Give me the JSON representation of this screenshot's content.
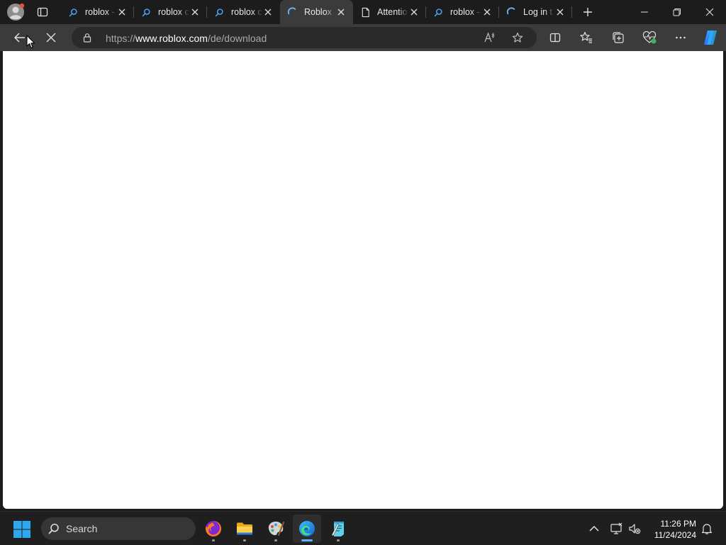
{
  "browser": {
    "tabs": [
      {
        "title": "roblox -",
        "favicon": "search-icon",
        "active": false
      },
      {
        "title": "roblox c",
        "favicon": "search-icon",
        "active": false
      },
      {
        "title": "roblox c",
        "favicon": "search-icon",
        "active": false
      },
      {
        "title": "Roblox",
        "favicon": "loading-spinner-icon",
        "active": true
      },
      {
        "title": "Attentio",
        "favicon": "document-icon",
        "active": false
      },
      {
        "title": "roblox -",
        "favicon": "search-icon",
        "active": false
      },
      {
        "title": "Log in t",
        "favicon": "loading-spinner-icon",
        "active": false
      }
    ],
    "address": {
      "scheme": "https://",
      "host": "www.roblox.com",
      "path": "/de/download"
    }
  },
  "taskbar": {
    "search_label": "Search",
    "apps": [
      "firefox-icon",
      "file-explorer-icon",
      "paint-icon",
      "edge-icon",
      "notepad-icon"
    ],
    "active_app": "edge-icon",
    "clock": {
      "time": "11:26 PM",
      "date": "11/24/2024"
    }
  },
  "colors": {
    "titlebar": "#1c1c1c",
    "toolbar": "#3b3b3b",
    "address_bar": "#2a2a2a",
    "page": "#ffffff",
    "accent": "#5fb2ff"
  }
}
